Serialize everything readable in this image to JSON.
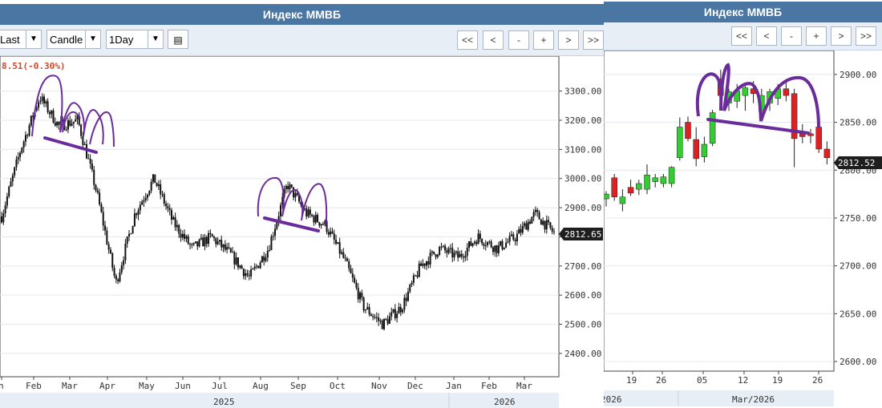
{
  "left": {
    "title": "Индекс ММВБ",
    "toolbar": {
      "price_type": "Last",
      "chart_type": "Candle",
      "interval": "1Day",
      "nav": [
        "<<",
        "<",
        "-",
        "+",
        ">",
        ">>"
      ]
    },
    "change_label": "8.51(-0.30%)",
    "price_tag": "2812.65"
  },
  "right": {
    "title": "Индекс ММВБ",
    "toolbar": {
      "nav": [
        "<<",
        "<",
        "-",
        "+",
        ">",
        ">>"
      ]
    },
    "price_tag": "2812.52"
  },
  "colors": {
    "header": "#4a76a3",
    "toolbar": "#e7eef6",
    "up_candle": "#33cc33",
    "down_candle": "#e02020",
    "annotation": "#6a2c9a",
    "change_text": "#d9442b"
  },
  "chart_data": [
    {
      "type": "candlestick",
      "panel": "left",
      "title": "Индекс ММВБ",
      "yticks": [
        "3300.00",
        "3200.00",
        "3100.00",
        "3000.00",
        "2900.00",
        "2800.00",
        "2700.00",
        "2600.00",
        "2500.00",
        "2400.00"
      ],
      "ylim": [
        2320,
        3420
      ],
      "xticks": [
        "n",
        "Feb",
        "Mar",
        "Apr",
        "May",
        "Jun",
        "Jul",
        "Aug",
        "Sep",
        "Oct",
        "Nov",
        "Dec",
        "Jan",
        "Feb",
        "Mar"
      ],
      "years": [
        "2025",
        "2026"
      ],
      "last_price": 2812.65,
      "series_close": [
        {
          "month": "Jan-25",
          "close": 2870
        },
        {
          "month": "Feb-25",
          "close": 3100
        },
        {
          "month": "Feb-25",
          "close": 3280
        },
        {
          "month": "Mar-25",
          "close": 3180
        },
        {
          "month": "Mar-25",
          "close": 3200
        },
        {
          "month": "Apr-25",
          "close": 2950
        },
        {
          "month": "Apr-25",
          "close": 2640
        },
        {
          "month": "Apr-25",
          "close": 2880
        },
        {
          "month": "May-25",
          "close": 3000
        },
        {
          "month": "May-25",
          "close": 2850
        },
        {
          "month": "Jun-25",
          "close": 2760
        },
        {
          "month": "Jun-25",
          "close": 2800
        },
        {
          "month": "Jul-25",
          "close": 2740
        },
        {
          "month": "Jul-25",
          "close": 2660
        },
        {
          "month": "Aug-25",
          "close": 2760
        },
        {
          "month": "Aug-25",
          "close": 2980
        },
        {
          "month": "Sep-25",
          "close": 2880
        },
        {
          "month": "Sep-25",
          "close": 2840
        },
        {
          "month": "Oct-25",
          "close": 2720
        },
        {
          "month": "Oct-25",
          "close": 2560
        },
        {
          "month": "Nov-25",
          "close": 2500
        },
        {
          "month": "Nov-25",
          "close": 2560
        },
        {
          "month": "Dec-25",
          "close": 2700
        },
        {
          "month": "Dec-25",
          "close": 2760
        },
        {
          "month": "Jan-26",
          "close": 2730
        },
        {
          "month": "Jan-26",
          "close": 2800
        },
        {
          "month": "Feb-26",
          "close": 2760
        },
        {
          "month": "Feb-26",
          "close": 2800
        },
        {
          "month": "Mar-26",
          "close": 2880
        },
        {
          "month": "Mar-26",
          "close": 2812.65
        }
      ]
    },
    {
      "type": "candlestick",
      "panel": "right",
      "title": "Индекс ММВБ",
      "yticks": [
        "2900.00",
        "2850.00",
        "2800.00",
        "2750.00",
        "2700.00",
        "2650.00",
        "2600.00"
      ],
      "ylim": [
        2590,
        2925
      ],
      "xticks": [
        "19",
        "26",
        "05",
        "12",
        "19",
        "26"
      ],
      "period_labels": [
        "2026",
        "Mar/2026"
      ],
      "last_price": 2812.52,
      "candles": [
        {
          "o": 2770,
          "h": 2778,
          "l": 2762,
          "c": 2775
        },
        {
          "o": 2792,
          "h": 2796,
          "l": 2768,
          "c": 2772
        },
        {
          "o": 2765,
          "h": 2780,
          "l": 2757,
          "c": 2772
        },
        {
          "o": 2782,
          "h": 2790,
          "l": 2773,
          "c": 2776
        },
        {
          "o": 2780,
          "h": 2790,
          "l": 2774,
          "c": 2786
        },
        {
          "o": 2780,
          "h": 2806,
          "l": 2775,
          "c": 2795
        },
        {
          "o": 2788,
          "h": 2796,
          "l": 2782,
          "c": 2792
        },
        {
          "o": 2786,
          "h": 2796,
          "l": 2782,
          "c": 2793
        },
        {
          "o": 2786,
          "h": 2804,
          "l": 2782,
          "c": 2803
        },
        {
          "o": 2813,
          "h": 2855,
          "l": 2810,
          "c": 2845
        },
        {
          "o": 2850,
          "h": 2856,
          "l": 2830,
          "c": 2833
        },
        {
          "o": 2832,
          "h": 2845,
          "l": 2804,
          "c": 2812
        },
        {
          "o": 2814,
          "h": 2835,
          "l": 2808,
          "c": 2827
        },
        {
          "o": 2828,
          "h": 2863,
          "l": 2825,
          "c": 2860
        },
        {
          "o": 2895,
          "h": 2905,
          "l": 2870,
          "c": 2878
        },
        {
          "o": 2870,
          "h": 2885,
          "l": 2862,
          "c": 2882
        },
        {
          "o": 2872,
          "h": 2890,
          "l": 2865,
          "c": 2883
        },
        {
          "o": 2878,
          "h": 2890,
          "l": 2862,
          "c": 2886
        },
        {
          "o": 2885,
          "h": 2893,
          "l": 2870,
          "c": 2880
        },
        {
          "o": 2862,
          "h": 2885,
          "l": 2855,
          "c": 2878
        },
        {
          "o": 2870,
          "h": 2885,
          "l": 2862,
          "c": 2882
        },
        {
          "o": 2875,
          "h": 2890,
          "l": 2868,
          "c": 2885
        },
        {
          "o": 2885,
          "h": 2895,
          "l": 2872,
          "c": 2878
        },
        {
          "o": 2880,
          "h": 2885,
          "l": 2803,
          "c": 2833
        },
        {
          "o": 2838,
          "h": 2848,
          "l": 2828,
          "c": 2835
        },
        {
          "o": 2838,
          "h": 2843,
          "l": 2828,
          "c": 2836
        },
        {
          "o": 2845,
          "h": 2852,
          "l": 2818,
          "c": 2822
        },
        {
          "o": 2822,
          "h": 2830,
          "l": 2806,
          "c": 2813
        }
      ]
    }
  ]
}
